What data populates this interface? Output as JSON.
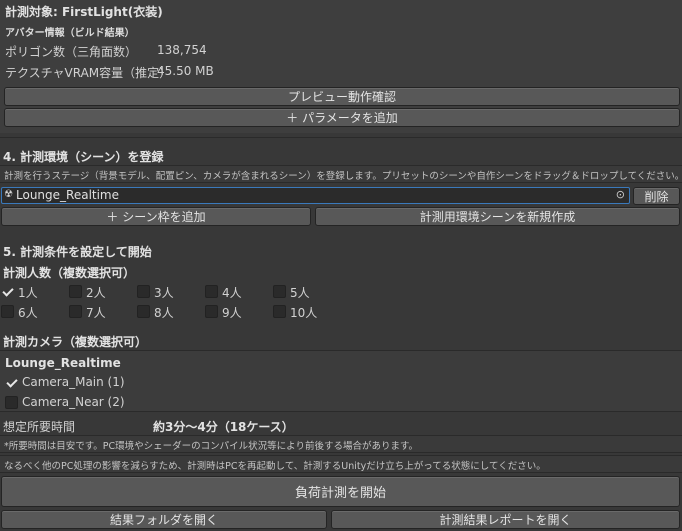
{
  "target": {
    "label": "計測対象: FirstLight(衣装)"
  },
  "avatar": {
    "heading": "アバター情報（ビルド結果）",
    "polygon_label": "ポリゴン数（三角面数）",
    "polygon_value": "138,754",
    "vram_label": "テクスチャVRAM容量（推定）",
    "vram_value": "45.50 MB"
  },
  "buttons": {
    "preview": "プレビュー動作確認",
    "add_param": "＋ パラメータを追加",
    "delete": "削除",
    "add_scene": "＋ シーン枠を追加",
    "new_scene": "計測用環境シーンを新規作成",
    "start": "負荷計測を開始",
    "open_folder": "結果フォルダを開く",
    "open_report": "計測結果レポートを開く"
  },
  "section4": {
    "title": "4. 計測環境（シーン）を登録",
    "description": "計測を行うステージ（背景モデル、配置ピン、カメラが含まれるシーン）を登録します。プリセットのシーンや自作シーンをドラッグ＆ドロップしてください。",
    "scene_field_value": "Lounge_Realtime"
  },
  "section5": {
    "title": "5. 計測条件を設定して開始",
    "people_heading": "計測人数（複数選択可）",
    "people": [
      {
        "label": "1人",
        "checked": true
      },
      {
        "label": "2人",
        "checked": false
      },
      {
        "label": "3人",
        "checked": false
      },
      {
        "label": "4人",
        "checked": false
      },
      {
        "label": "5人",
        "checked": false
      },
      {
        "label": "6人",
        "checked": false
      },
      {
        "label": "7人",
        "checked": false
      },
      {
        "label": "8人",
        "checked": false
      },
      {
        "label": "9人",
        "checked": false
      },
      {
        "label": "10人",
        "checked": false
      }
    ],
    "camera_heading": "計測カメラ（複数選択可）",
    "camera_scene": "Lounge_Realtime",
    "cameras": [
      {
        "label": "Camera_Main  (1)",
        "checked": true
      },
      {
        "label": "Camera_Near  (2)",
        "checked": false
      }
    ],
    "estimate_label": "想定所要時間",
    "estimate_value": "約3分〜4分（18ケース）",
    "note1": "*所要時間は目安です。PC環境やシェーダーのコンパイル状況等により前後する場合があります。",
    "note2": "なるべく他のPC処理の影響を減らすため、計測時はPCを再起動して、計測するUnityだけ立ち上がってる状態にしてください。"
  },
  "colors": {
    "background": "#383838",
    "field_focus": "#3a79bb",
    "button": "#585858"
  }
}
